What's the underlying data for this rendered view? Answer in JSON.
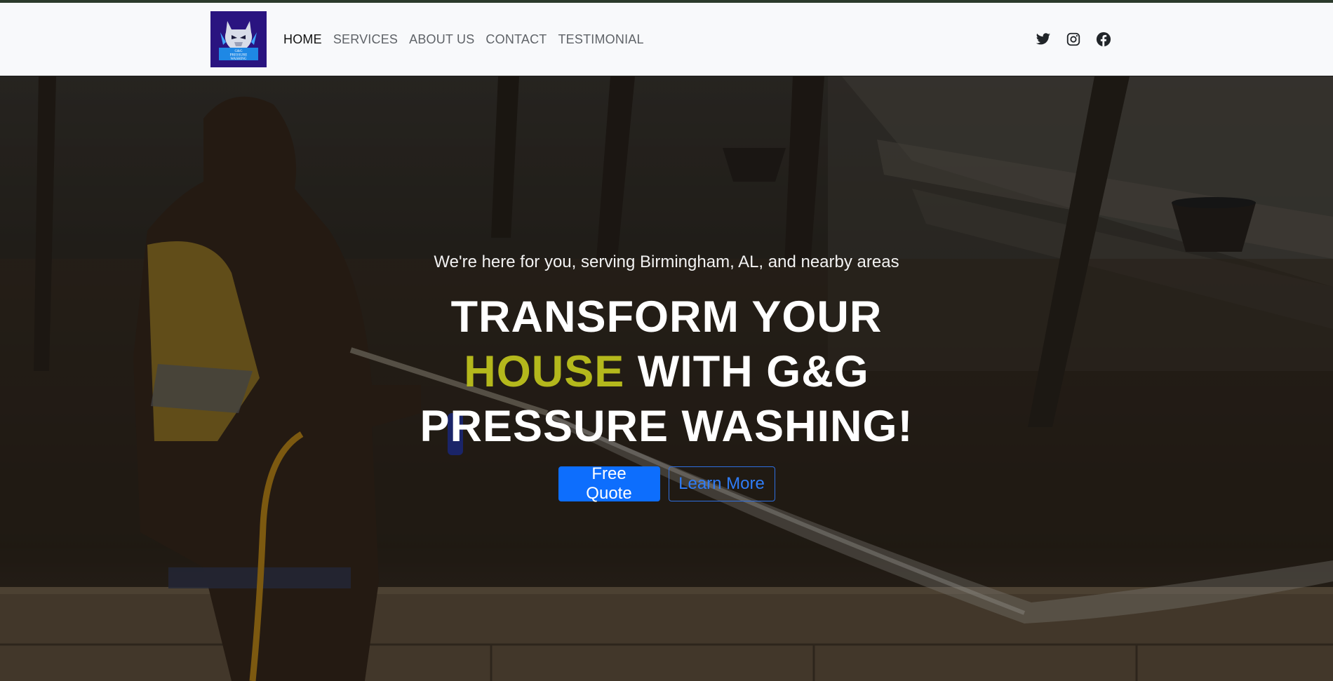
{
  "brand": {
    "logo_alt": "G&G Pressure Washing",
    "logo_text_line1": "G&G",
    "logo_text_line2": "PRESSURE",
    "logo_text_line3": "WASHING",
    "logo_bg_color": "#2a1480"
  },
  "nav": {
    "items": [
      {
        "label": "HOME",
        "active": true
      },
      {
        "label": "SERVICES",
        "active": false
      },
      {
        "label": "ABOUT US",
        "active": false
      },
      {
        "label": "CONTACT",
        "active": false
      },
      {
        "label": "TESTIMONIAL",
        "active": false
      }
    ]
  },
  "socials": [
    {
      "icon": "twitter-icon"
    },
    {
      "icon": "instagram-icon"
    },
    {
      "icon": "facebook-icon"
    }
  ],
  "hero": {
    "subtitle": "We're here for you, serving Birmingham, AL, and nearby areas",
    "title_part1": "TRANSFORM YOUR ",
    "title_accent": "HOUSE",
    "title_part2": " WITH G&G PRESSURE WASHING!",
    "accent_color": "#b4b81c",
    "primary_button": "Free Quote",
    "secondary_button": "Learn More"
  },
  "colors": {
    "primary": "#0d6efd",
    "nav_bg": "#f8f9fb"
  }
}
